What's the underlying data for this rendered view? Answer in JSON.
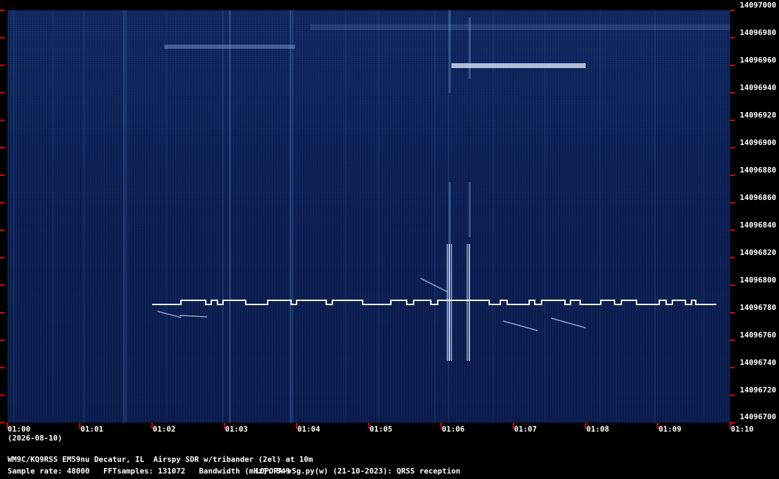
{
  "colors": {
    "background": "#000000",
    "spectrogram_bg": "#0c2157",
    "tick": "#e00000",
    "signal": "#ffffff",
    "label": "#ffffff"
  },
  "y_axis": {
    "labels": [
      "14097000",
      "14096980",
      "14096960",
      "14096940",
      "14096920",
      "14096900",
      "14096880",
      "14096860",
      "14096840",
      "14096820",
      "14096800",
      "14096780",
      "14096760",
      "14096740",
      "14096720",
      "14096700"
    ]
  },
  "x_axis": {
    "labels": [
      "01:00",
      "01:01",
      "01:02",
      "01:03",
      "01:04",
      "01:05",
      "01:06",
      "01:07",
      "01:08",
      "01:09",
      "01:10"
    ],
    "date": "(2026-08-10)"
  },
  "footer": {
    "station": "WM9C/KQ9RSS EM59nu Decatur, IL  Airspy SDR w/tribander (2el) at 10m",
    "params": "Sample rate: 48000   FFTsamples: 131072   Bandwidth (mHz): 549",
    "software": "LOPORA-v5g.py(w) (21-10-2023): QRSS reception"
  }
}
